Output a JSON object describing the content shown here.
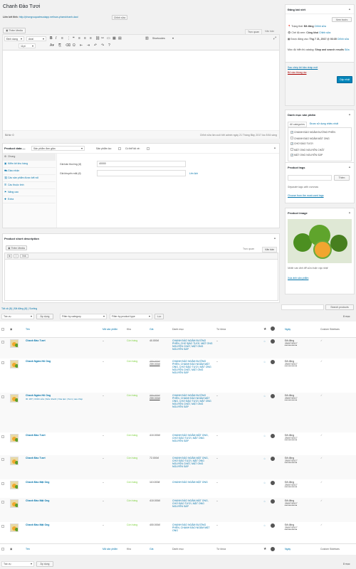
{
  "title_field": "Chanh Đào Tươi",
  "permalink": {
    "label": "Liên kết tĩnh:",
    "url": "http://phongvuquatmuoiapp.net/san-pham/chanh-dao/",
    "edit_btn": "Chỉnh sửa"
  },
  "editor": {
    "add_media": "Thêm Media",
    "tab_visual": "Trực quan",
    "tab_text": "Văn bản",
    "format_select": "Định dạng",
    "font_select": "Arial",
    "size_select": "11pt",
    "shortcodes": "Shortcodes",
    "word_count": "Số từ: 0",
    "last_edit": "Chỉnh sửa lần cuối bởi admin ngày 21 Tháng Bảy, 2017 lúc 8:54 sáng"
  },
  "publish": {
    "title": "Đăng bài viết",
    "preview_btn": "Xem trước",
    "status_label": "Trạng thái:",
    "status_value": "Đã đăng",
    "status_edit": "Chỉnh sửa",
    "visibility_label": "Chế độ xem:",
    "visibility_value": "Công khai",
    "visibility_edit": "Chỉnh sửa",
    "published_label": "Được đăng vào:",
    "published_value": "Thg 7 21, 2017 @ 03:35",
    "published_edit": "Chỉnh sửa",
    "catalog_label": "Mức độ hiển thị catalog:",
    "catalog_value": "Shop and search results",
    "catalog_edit": "Sửa",
    "featured_link": "Sao chép tới bản nháp mới",
    "trash_link": "Bỏ vào thùng rác",
    "update_btn": "Cập nhật"
  },
  "product_data": {
    "title": "Product data —",
    "type_select": "Sản phẩm đơn giản",
    "virtual_label": "Sản phẩm ảo:",
    "download_label": "Có thể tải về:",
    "tabs": [
      {
        "icon": "⚙",
        "label": "Chung"
      },
      {
        "icon": "▣",
        "label": "Kiểm kê kho hàng"
      },
      {
        "icon": "⛟",
        "label": "Giao nhận"
      },
      {
        "icon": "⛓",
        "label": "Các sản phẩm được kết nối"
      },
      {
        "icon": "☰",
        "label": "Các thuộc tính"
      },
      {
        "icon": "⚑",
        "label": "Nâng cao"
      },
      {
        "icon": "✚",
        "label": "Extra"
      }
    ],
    "regular_price_label": "Giá bán thường (đ)",
    "regular_price_value": "40000",
    "sale_price_label": "Giá khuyến mãi (đ)",
    "sale_price_value": "",
    "schedule_link": "Lên lịch"
  },
  "short_desc": {
    "title": "Product short description",
    "add_media": "Thêm Media",
    "tab_visual": "Trực quan",
    "tab_text": "Văn bản",
    "btn_b": "b",
    "btn_i": "i",
    "btn_link": "link"
  },
  "categories": {
    "title": "Danh mục sản phẩm",
    "tab_all": "All categories",
    "tab_most": "Được sử dụng nhiều nhất",
    "items": [
      {
        "label": "CHANH ĐÀO NGÂM ĐƯỜNG PHÈN",
        "checked": true
      },
      {
        "label": "CHANH ĐÀO NGÂM MẬT ONG",
        "checked": false
      },
      {
        "label": "CHƠ ĐÀO TƯƠI",
        "checked": true
      },
      {
        "label": "MẬT ONG NGUYÊN CHẤT",
        "checked": false
      },
      {
        "label": "MẬT ONG NGUYÊN SÁP",
        "checked": true
      }
    ],
    "add_link": "+ Add new category"
  },
  "tags": {
    "title": "Product tags",
    "add_btn": "Thêm",
    "hint": "Separate tags with commas",
    "choose_link": "Choose from the most used tags"
  },
  "product_image": {
    "title": "Product image",
    "hint": "Nhấn vào ảnh để sửa hoặc cập nhật",
    "remove_link": "Xóa ảnh sản phẩm"
  },
  "list": {
    "subsubsub": "Tất cả (8) | Đã đăng (8) | Sorting",
    "search_btn": "Search products",
    "bulk_select": "Tác vụ",
    "apply_btn": "Áp dụng",
    "filter_cat": "Filter by category",
    "filter_type": "Filter by product type",
    "filter_btn": "Lọc",
    "count": "8 mục",
    "columns": {
      "name": "Tên",
      "sku": "Mã sản phẩm",
      "stock": "Kho",
      "price": "Giá",
      "cats": "Danh mục",
      "tags": "Từ khóa",
      "date": "Ngày",
      "sidebar": "Custom Sidebars"
    },
    "rows": [
      {
        "name": "Chanh Đào Tươi",
        "actions": "",
        "sku": "–",
        "stock": "Còn hàng",
        "price_old": "",
        "price": "40.000đ",
        "cats": "CHANH ĐÀO NGÂM ĐƯỜNG PHÈN, CHƠ ĐÀO TƯƠI, MẬT ONG NGUYÊN CHẤT, MẬT ONG NGUYÊN SÁP",
        "tags": "–",
        "status": "Đã đăng",
        "date": "25/07/2017"
      },
      {
        "name": "Chanh Ngâm Hũ Ong",
        "actions": "",
        "sku": "–",
        "stock": "Còn hàng",
        "price_old": "450.000đ",
        "price": "259.000đ",
        "cats": "CHANH ĐÀO NGÂM ĐƯỜNG PHÈN, CHANH ĐÀO NGÂM MẬT ONG, CHƠ ĐÀO TƯƠI, MẬT ONG NGUYÊN CHẤT, MẬT ONG NGUYÊN SÁP",
        "tags": "–",
        "status": "Đã đăng",
        "date": "25/07/2017"
      },
      {
        "name": "Chanh Ngâm Hũ Ong",
        "actions": "ID: 187 | Chỉnh sửa | Sửa nhanh | Xóa tạm | Xem | sao chép",
        "sku": "–",
        "stock": "Còn hàng",
        "price_old": "350.000đ",
        "price": "259.000đ",
        "cats": "CHANH ĐÀO NGÂM ĐƯỜNG PHÈN, CHANH ĐÀO NGÂM MẬT ONG, CHƠ ĐÀO TƯƠI, MẬT ONG NGUYÊN CHẤT, MẬT ONG NGUYÊN SÁP",
        "tags": "–",
        "status": "Đã đăng",
        "date": "25/07/2017"
      },
      {
        "name": "Chanh Đào Tươi",
        "actions": "",
        "sku": "–",
        "stock": "Còn hàng",
        "price_old": "",
        "price": "410.000đ",
        "cats": "CHANH ĐÀO NGÂM MẬT ONG, CHƠ ĐÀO TƯƠI, MẬT ONG NGUYÊN SÁP",
        "tags": "–",
        "status": "Đã đăng",
        "date": "25/07/2017"
      },
      {
        "name": "Chanh Đào Tươi",
        "actions": "",
        "sku": "–",
        "stock": "Còn hàng",
        "price_old": "",
        "price": "72.000đ",
        "cats": "CHANH ĐÀO NGÂM MẬT ONG, CHƠ ĐÀO TƯƠI, MẬT ONG NGUYÊN CHẤT, MẬT ONG NGUYÊN SÁP",
        "tags": "–",
        "status": "Đã đăng",
        "date": "25/07/2017"
      },
      {
        "name": "Chanh Đào Mật Ong",
        "actions": "",
        "sku": "–",
        "stock": "Còn hàng",
        "price_old": "",
        "price": "110.000đ",
        "cats": "CHANH ĐÀO NGÂM MẬT ONG",
        "tags": "–",
        "status": "Đã đăng",
        "date": "25/07/2017"
      },
      {
        "name": "Chanh Đào Mật Ong",
        "actions": "",
        "sku": "–",
        "stock": "Còn hàng",
        "price_old": "",
        "price": "410.000đ",
        "cats": "CHANH ĐÀO NGÂM MẬT ONG, CHƠ ĐÀO TƯƠI, MẬT ONG NGUYÊN SÁP",
        "tags": "–",
        "status": "Đã đăng",
        "date": "25/07/2017"
      },
      {
        "name": "Chanh Đào Mật Ong",
        "actions": "",
        "sku": "–",
        "stock": "Còn hàng",
        "price_old": "",
        "price": "400.000đ",
        "cats": "CHANH ĐÀO NGÂM ĐƯỜNG PHÈN, CHANH ĐÀO NGÂM MẬT ONG",
        "tags": "–",
        "status": "Đã đăng",
        "date": "25/07/2017"
      }
    ],
    "footer_bulk": "Tác vụ",
    "footer_apply": "Áp dụng",
    "footer_count": "8 mục"
  },
  "colors": {
    "accent": "#0073aa",
    "in_stock": "#7ad03a",
    "primary_btn": "#0085ba"
  }
}
